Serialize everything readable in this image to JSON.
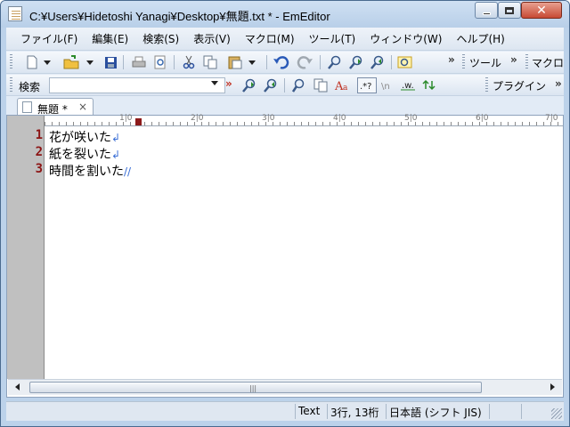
{
  "window": {
    "title": "C:¥Users¥Hidetoshi Yanagi¥Desktop¥無題.txt * - EmEditor"
  },
  "menu": [
    "ファイル(F)",
    "編集(E)",
    "検索(S)",
    "表示(V)",
    "マクロ(M)",
    "ツール(T)",
    "ウィンドウ(W)",
    "ヘルプ(H)"
  ],
  "toolbar": {
    "tools_label": "ツール",
    "macro_label": "マクロ",
    "chevron": "»"
  },
  "searchbar": {
    "label": "検索",
    "value": "",
    "plugins_label": "プラグイン",
    "chevron": "»"
  },
  "tab": {
    "label": "無題 *",
    "close": "×"
  },
  "ruler": {
    "labels": [
      "1|0",
      "2|0",
      "3|0",
      "4|0",
      "5|0",
      "6|0",
      "7|0"
    ]
  },
  "editor": {
    "lines": [
      {
        "no": "1",
        "text": "花が咲いた",
        "eol": "↲"
      },
      {
        "no": "2",
        "text": "紙を裂いた",
        "eol": "↲"
      },
      {
        "no": "3",
        "text": "時間を割いた",
        "eol": "//"
      }
    ]
  },
  "statusbar": {
    "mode": "Text",
    "position": "3行, 13桁",
    "encoding": "日本語 (シフト JIS)"
  },
  "colors": {
    "line_number": "#8c1414",
    "eol_mark": "#3b6fd6",
    "gutter": "#c0c0c0",
    "chrome": "#e2ebf6"
  }
}
